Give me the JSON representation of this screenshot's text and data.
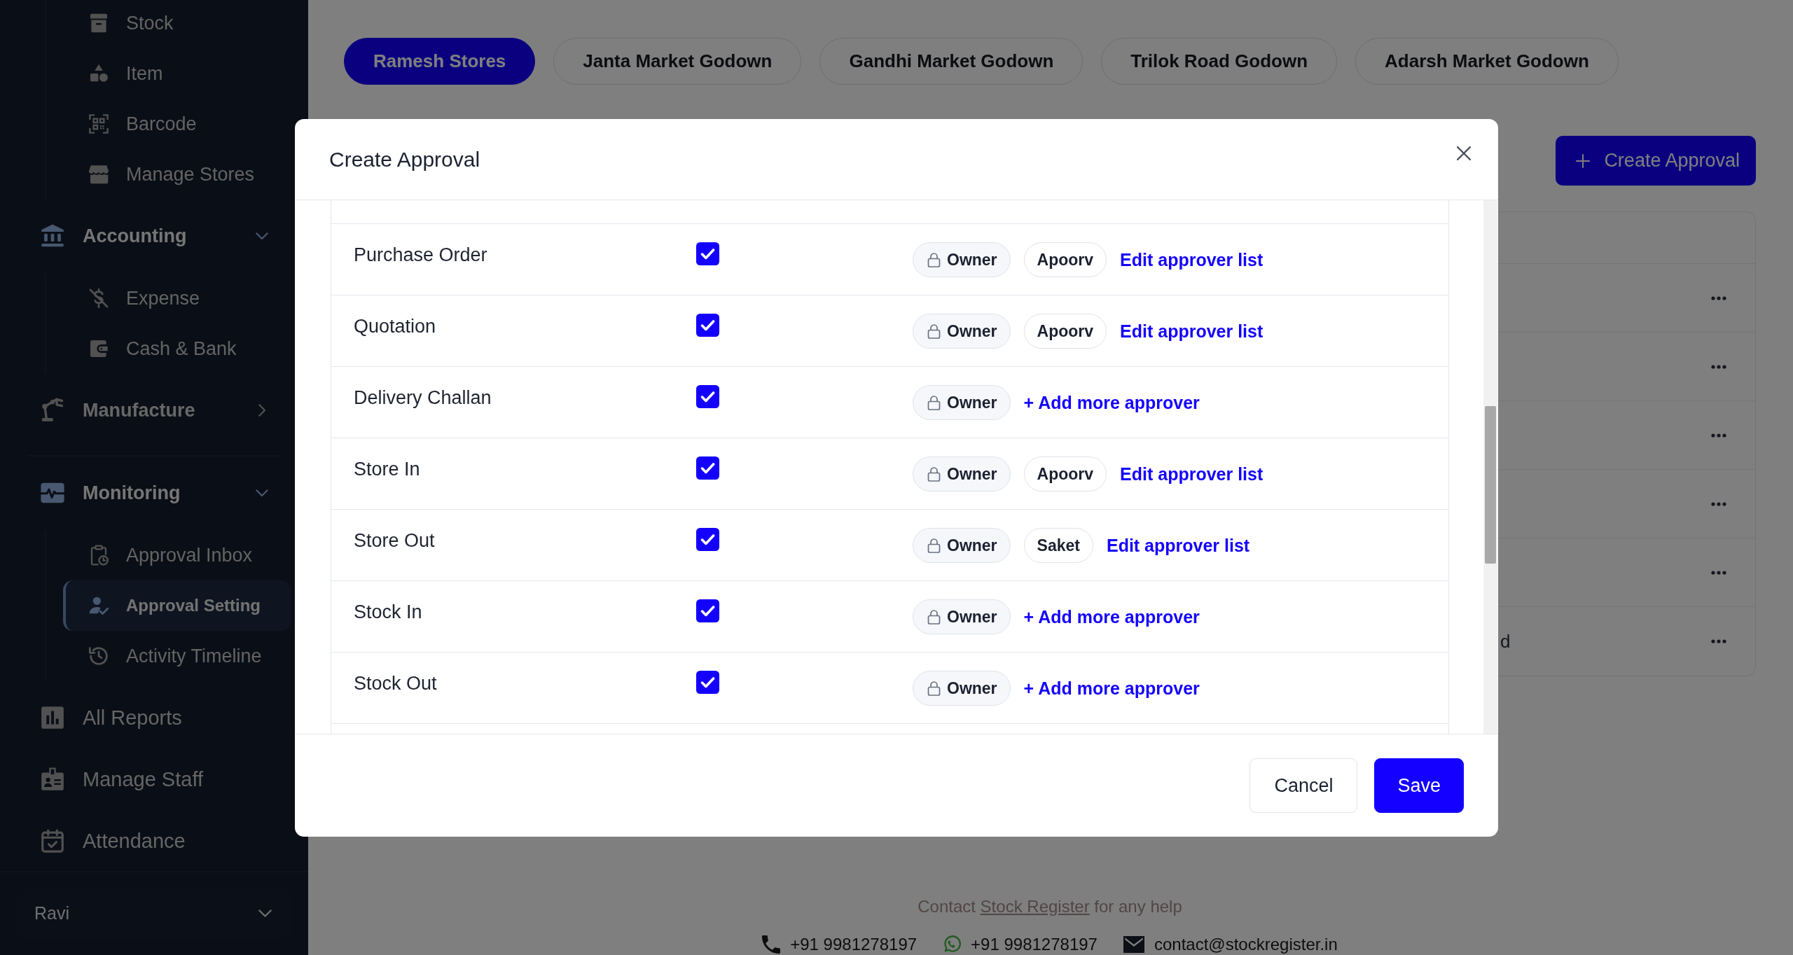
{
  "sidebar": {
    "blocks": [
      {
        "sections": [
          {
            "kind": "continued",
            "children": [
              {
                "label": "Stock",
                "selected": false
              },
              {
                "label": "Item",
                "selected": false
              },
              {
                "label": "Barcode",
                "selected": false
              },
              {
                "label": "Manage Stores",
                "selected": false
              }
            ]
          },
          {
            "kind": "group",
            "label": "Accounting",
            "expanded": true,
            "children": [
              {
                "label": "Expense",
                "selected": false
              },
              {
                "label": "Cash & Bank",
                "selected": false
              }
            ]
          },
          {
            "kind": "group",
            "label": "Manufacture",
            "expanded": false
          }
        ]
      },
      {
        "sections": [
          {
            "kind": "group",
            "label": "Monitoring",
            "expanded": true,
            "children": [
              {
                "label": "Approval Inbox",
                "selected": false
              },
              {
                "label": "Approval Setting",
                "selected": true
              },
              {
                "label": "Activity Timeline",
                "selected": false
              }
            ]
          },
          {
            "kind": "link",
            "label": "All Reports",
            "selected": false
          },
          {
            "kind": "link",
            "label": "Manage Staff",
            "selected": false
          },
          {
            "kind": "link",
            "label": "Attendance",
            "selected": false
          }
        ]
      }
    ],
    "user": {
      "name": "Ravi"
    }
  },
  "tabs": [
    {
      "label": "Ramesh Stores",
      "selected": true
    },
    {
      "label": "Janta Market Godown",
      "selected": false
    },
    {
      "label": "Gandhi Market Godown",
      "selected": false
    },
    {
      "label": "Trilok Road Godown",
      "selected": false
    },
    {
      "label": "Adarsh Market Godown",
      "selected": false
    }
  ],
  "page_header": {
    "button": "Create Approval"
  },
  "table": {
    "rows": [
      {},
      {},
      {},
      {},
      {},
      {
        "column_2": "d"
      }
    ]
  },
  "dialog": {
    "title": "Create Approval",
    "rows": [
      {
        "name": "Purchase Order",
        "checked": true,
        "approvers": [
          {
            "kind": "locked",
            "label": "Owner"
          },
          {
            "kind": "user",
            "label": "Apoorv"
          }
        ],
        "edit_link": "Edit approver list"
      },
      {
        "name": "Quotation",
        "checked": true,
        "approvers": [
          {
            "kind": "locked",
            "label": "Owner"
          },
          {
            "kind": "user",
            "label": "Apoorv"
          }
        ],
        "edit_link": "Edit approver list"
      },
      {
        "name": "Delivery Challan",
        "checked": true,
        "approvers": [
          {
            "kind": "locked",
            "label": "Owner"
          }
        ],
        "add_link": "+ Add more approver"
      },
      {
        "name": "Store In",
        "checked": true,
        "approvers": [
          {
            "kind": "locked",
            "label": "Owner"
          },
          {
            "kind": "user",
            "label": "Apoorv"
          }
        ],
        "edit_link": "Edit approver list"
      },
      {
        "name": "Store Out",
        "checked": true,
        "approvers": [
          {
            "kind": "locked",
            "label": "Owner"
          },
          {
            "kind": "user",
            "label": "Saket"
          }
        ],
        "edit_link": "Edit approver list"
      },
      {
        "name": "Stock In",
        "checked": true,
        "approvers": [
          {
            "kind": "locked",
            "label": "Owner"
          }
        ],
        "add_link": "+ Add more approver"
      },
      {
        "name": "Stock Out",
        "checked": true,
        "approvers": [
          {
            "kind": "locked",
            "label": "Owner"
          }
        ],
        "add_link": "+ Add more approver"
      }
    ],
    "buttons": [
      {
        "kind": "cancel",
        "label": "Cancel"
      },
      {
        "kind": "save",
        "label": "Save"
      }
    ]
  },
  "footer": {
    "help": {
      "before": "Contact",
      "link": "Stock Register",
      "after": "for any help"
    },
    "contacts": [
      {
        "kind": "phone",
        "text": "+91 9981278197"
      },
      {
        "kind": "chat",
        "text": "+91 9981278197"
      },
      {
        "kind": "email",
        "text": "contact@stockregister.in"
      }
    ]
  }
}
